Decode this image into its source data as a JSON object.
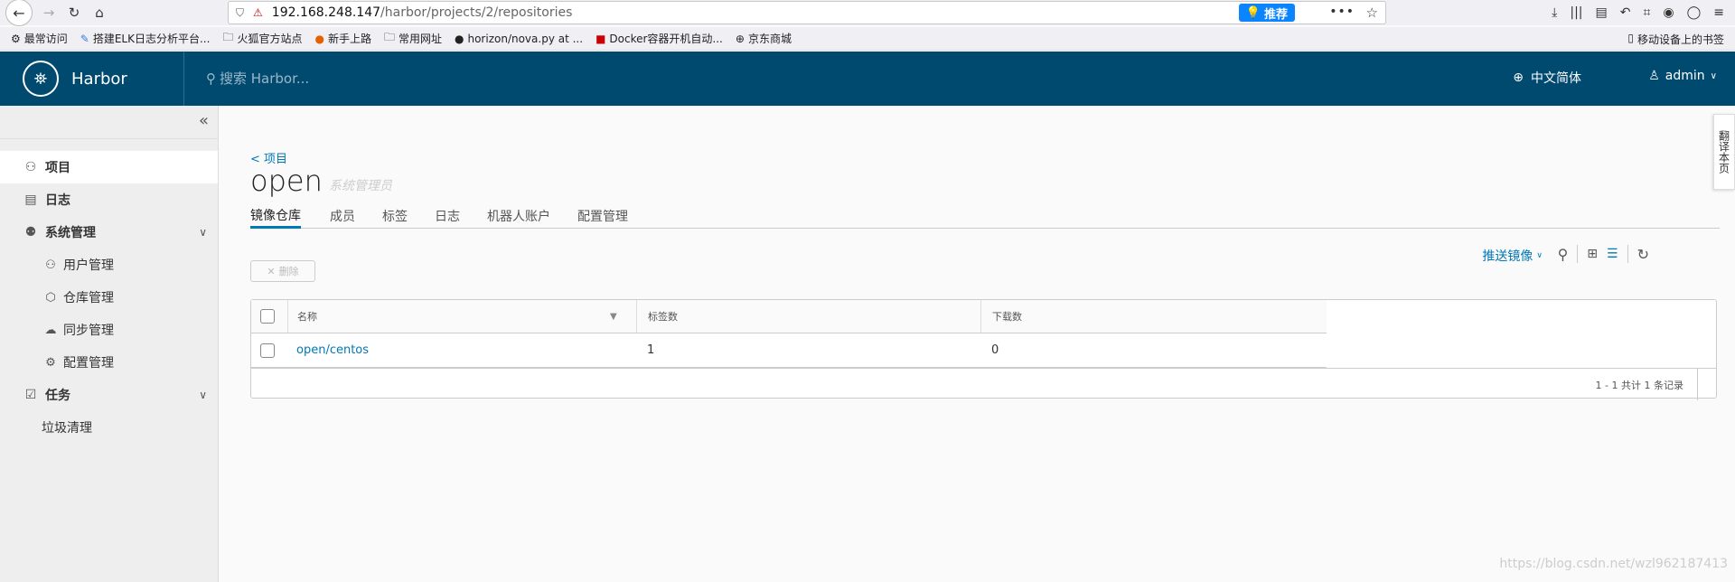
{
  "browser": {
    "url_host": "192.168.248.147",
    "url_path": "/harbor/projects/2/repositories",
    "recommend_label": "推荐",
    "bookmarks": [
      {
        "label": "最常访问",
        "icon": "gear-icon"
      },
      {
        "label": "搭建ELK日志分析平台...",
        "icon": "blog-icon"
      },
      {
        "label": "火狐官方站点",
        "icon": "folder-icon"
      },
      {
        "label": "新手上路",
        "icon": "firefox-icon"
      },
      {
        "label": "常用网址",
        "icon": "folder-icon"
      },
      {
        "label": "horizon/nova.py at ...",
        "icon": "github-icon"
      },
      {
        "label": "Docker容器开机自动...",
        "icon": "csdn-icon"
      },
      {
        "label": "京东商城",
        "icon": "globe-icon"
      }
    ],
    "mobile_bookmarks": "移动设备上的书签"
  },
  "header": {
    "brand": "Harbor",
    "search_placeholder": "搜索 Harbor...",
    "language": "中文简体",
    "user": "admin"
  },
  "sidebar": {
    "items": [
      {
        "label": "项目",
        "icon": "project-icon",
        "active": true
      },
      {
        "label": "日志",
        "icon": "log-icon"
      },
      {
        "label": "系统管理",
        "icon": "admin-icon",
        "expandable": true
      },
      {
        "label": "用户管理",
        "icon": "users-icon",
        "sub": true
      },
      {
        "label": "仓库管理",
        "icon": "box-icon",
        "sub": true
      },
      {
        "label": "同步管理",
        "icon": "cloud-sync-icon",
        "sub": true
      },
      {
        "label": "配置管理",
        "icon": "gear-icon",
        "sub": true
      },
      {
        "label": "任务",
        "icon": "task-icon",
        "expandable": true
      },
      {
        "label": "垃圾清理",
        "sub": true
      }
    ]
  },
  "main": {
    "back_link": "< 项目",
    "title": "open",
    "subtitle": "系统管理员",
    "tabs": [
      "镜像仓库",
      "成员",
      "标签",
      "日志",
      "机器人账户",
      "配置管理"
    ],
    "push_label": "推送镜像",
    "delete_label": "删除",
    "columns": [
      "名称",
      "标签数",
      "下载数"
    ],
    "rows": [
      {
        "name": "open/centos",
        "tags": "1",
        "pulls": "0"
      }
    ],
    "pagination": "1 - 1 共计 1 条记录"
  },
  "side_tab": "翻译本页",
  "watermark": "https://blog.csdn.net/wzl962187413",
  "colors": {
    "header": "#004a70",
    "accent": "#0079b8"
  }
}
